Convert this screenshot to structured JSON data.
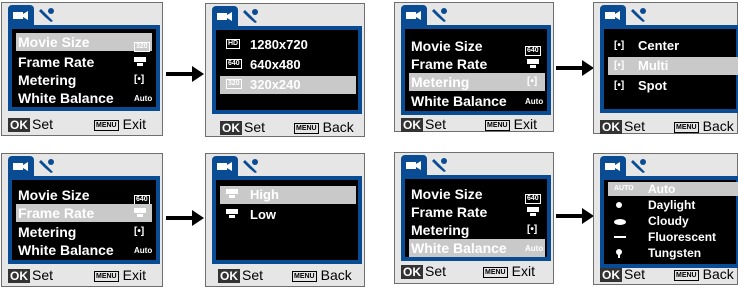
{
  "menu": {
    "movie_size": "Movie Size",
    "frame_rate": "Frame Rate",
    "metering": "Metering",
    "white_balance": "White Balance"
  },
  "values": {
    "size_320": "320",
    "size_640": "640",
    "metering_icon": "[•]",
    "auto": "Auto"
  },
  "footer": {
    "ok": "OK",
    "set": "Set",
    "menu": "MENU",
    "exit": "Exit",
    "back": "Back"
  },
  "options": {
    "size": [
      "1280x720",
      "640x480",
      "320x240"
    ],
    "size_icons": [
      "HD",
      "640",
      "320"
    ],
    "metering": [
      "Center",
      "Multi",
      "Spot"
    ],
    "frame": [
      "High",
      "Low"
    ],
    "wb": [
      "Auto",
      "Daylight",
      "Cloudy",
      "Fluorescent",
      "Tungsten"
    ],
    "wb_auto_icon": "AUTO"
  },
  "colors": {
    "accent": "#0a4c93",
    "highlight": "#c9c9c9",
    "screen": "#000000"
  }
}
